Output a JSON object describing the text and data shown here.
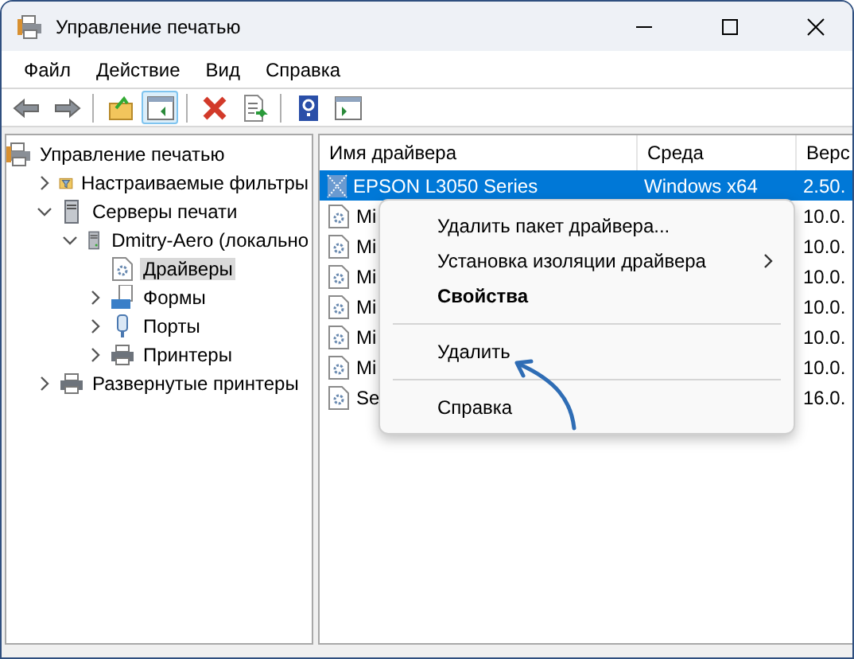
{
  "window": {
    "title": "Управление печатью"
  },
  "menu": [
    "Файл",
    "Действие",
    "Вид",
    "Справка"
  ],
  "toolbar": [
    {
      "kind": "back",
      "pressed": false
    },
    {
      "kind": "forward",
      "pressed": false
    },
    {
      "kind": "sep"
    },
    {
      "kind": "up",
      "pressed": false
    },
    {
      "kind": "tree",
      "pressed": true
    },
    {
      "kind": "sep"
    },
    {
      "kind": "delete",
      "pressed": false
    },
    {
      "kind": "export",
      "pressed": false
    },
    {
      "kind": "sep"
    },
    {
      "kind": "help",
      "pressed": false
    },
    {
      "kind": "pane",
      "pressed": false
    }
  ],
  "tree": [
    {
      "label": "Управление печатью",
      "kind": "root",
      "selected": false,
      "children": [
        {
          "label": "Настраиваемые фильтры",
          "kind": "filter",
          "expanded": false,
          "selected": false
        },
        {
          "label": "Серверы печати",
          "kind": "servers",
          "expanded": true,
          "selected": false,
          "children": [
            {
              "label": "Dmitry-Aero (локально",
              "kind": "server",
              "expanded": true,
              "selected": false,
              "children": [
                {
                  "label": "Драйверы",
                  "kind": "driver",
                  "selected": true
                },
                {
                  "label": "Формы",
                  "kind": "forms",
                  "expanded": false,
                  "selected": false
                },
                {
                  "label": "Порты",
                  "kind": "port",
                  "expanded": false,
                  "selected": false
                },
                {
                  "label": "Принтеры",
                  "kind": "printer",
                  "expanded": false,
                  "selected": false
                }
              ]
            }
          ]
        },
        {
          "label": "Развернутые принтеры",
          "kind": "printer",
          "expanded": false,
          "selected": false
        }
      ]
    }
  ],
  "table": {
    "columns": [
      "Имя драйвера",
      "Среда",
      "Верс"
    ],
    "rows": [
      {
        "name": "EPSON L3050 Series",
        "environment": "Windows x64",
        "version": "2.50.",
        "selected": true
      },
      {
        "name": "Mi",
        "version": "10.0.",
        "selected": false
      },
      {
        "name": "Mi",
        "version": "10.0.",
        "selected": false
      },
      {
        "name": "Mi",
        "version": "10.0.",
        "selected": false
      },
      {
        "name": "Mi",
        "version": "10.0.",
        "selected": false
      },
      {
        "name": "Mi",
        "version": "10.0.",
        "selected": false
      },
      {
        "name": "Mi",
        "version": "10.0.",
        "selected": false
      },
      {
        "name": "Se",
        "version": "16.0.",
        "selected": false
      }
    ]
  },
  "context_menu": [
    {
      "kind": "item",
      "label": "Удалить пакет драйвера...",
      "bold": false,
      "submenu": false
    },
    {
      "kind": "item",
      "label": "Установка изоляции драйвера",
      "bold": false,
      "submenu": true
    },
    {
      "kind": "item",
      "label": "Свойства",
      "bold": true,
      "submenu": false
    },
    {
      "kind": "separator"
    },
    {
      "kind": "item",
      "label": "Удалить",
      "bold": false,
      "submenu": false
    },
    {
      "kind": "separator"
    },
    {
      "kind": "item",
      "label": "Справка",
      "bold": false,
      "submenu": false
    }
  ]
}
